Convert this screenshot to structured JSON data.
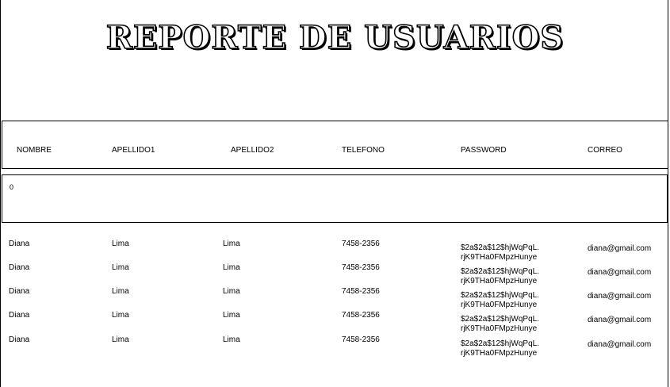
{
  "report": {
    "title": "REPORTE DE USUARIOS"
  },
  "columns": [
    "NOMBRE",
    "APELLIDO1",
    "APELLIDO2",
    "TELEFONO",
    "PASSWORD",
    "CORREO"
  ],
  "summary": {
    "total": "0"
  },
  "rows": [
    {
      "nombre": "Diana",
      "apellido1": "Lima",
      "apellido2": "Lima",
      "telefono": "7458-2356",
      "password_line1": "$2a$2a$12$hjWqPqL.",
      "password_line2": "rjK9THa0FMpzHunye",
      "correo": "diana@gmail.com"
    },
    {
      "nombre": "Diana",
      "apellido1": "Lima",
      "apellido2": "Lima",
      "telefono": "7458-2356",
      "password_line1": "$2a$2a$12$hjWqPqL.",
      "password_line2": "rjK9THa0FMpzHunye",
      "correo": "diana@gmail.com"
    },
    {
      "nombre": "Diana",
      "apellido1": "Lima",
      "apellido2": "Lima",
      "telefono": "7458-2356",
      "password_line1": "$2a$2a$12$hjWqPqL.",
      "password_line2": "rjK9THa0FMpzHunye",
      "correo": "diana@gmail.com"
    },
    {
      "nombre": "Diana",
      "apellido1": "Lima",
      "apellido2": "Lima",
      "telefono": "7458-2356",
      "password_line1": "$2a$2a$12$hjWqPqL.",
      "password_line2": "rjK9THa0FMpzHunye",
      "correo": "diana@gmail.com"
    },
    {
      "nombre": "Diana",
      "apellido1": "Lima",
      "apellido2": "Lima",
      "telefono": "7458-2356",
      "password_line1": "$2a$2a$12$hjWqPqL.",
      "password_line2": "rjK9THa0FMpzHunye",
      "correo": "diana@gmail.com"
    }
  ]
}
